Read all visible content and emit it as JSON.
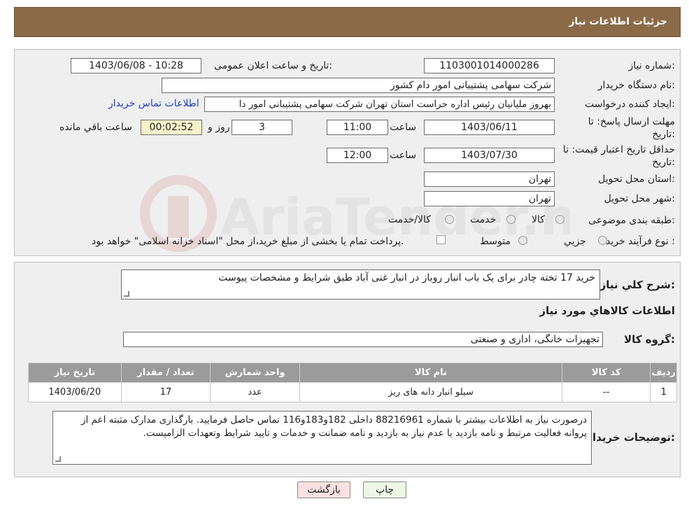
{
  "header": {
    "title": "جزئیات اطلاعات نیاز"
  },
  "form": {
    "need_number_label": "شماره نیاز:",
    "need_number": "1103001014000286",
    "announce_label": "تاریخ و ساعت اعلان عمومی:",
    "announce_value": "1403/06/08 - 10:28",
    "buyer_org_label": "نام دستگاه خریدار:",
    "buyer_org": "شرکت سهامی پشتیبانی امور دام کشور",
    "creator_label": "ایجاد کننده درخواست:",
    "creator": "بهروز ملیانیان رئیس اداره حراست استان تهران شرکت سهامی پشتیبانی امور دا",
    "contact_link": "اطلاعات تماس خریدار",
    "deadline_label": "مهلت ارسال پاسخ: تا تاریخ:",
    "deadline_date": "1403/06/11",
    "time_label": "ساعت",
    "deadline_time": "11:00",
    "days_value": "3",
    "days_label": "روز و",
    "remaining_time": "00:02:52",
    "remaining_label": "ساعت باقي مانده",
    "validity_label": "حداقل تاریخ اعتبار قیمت: تا تاریخ:",
    "validity_date": "1403/07/30",
    "validity_time": "12:00",
    "province_label": "استان محل تحویل:",
    "province": "تهران",
    "city_label": "شهر محل تحویل:",
    "city": "تهران",
    "category_label": "طبقه بندی موضوعی:",
    "category_options": [
      "کالا",
      "خدمت",
      "کالا/خدمت"
    ],
    "process_label": "نوع فرآیند خرید :",
    "process_options": [
      "جزیي",
      "متوسط"
    ],
    "process_note": "پرداخت تمام یا بخشی از مبلغ خرید،از محل \"اسناد خزانه اسلامی\" خواهد بود."
  },
  "details": {
    "summary_label": "شرح کلي نیاز:",
    "summary": "خرید 17 تخته چادر برای یک باب انبار روباز در انبار غنی آباد طبق شرایط و مشخصات پیوست",
    "goods_info_title": "اطلاعات کالاهاي مورد نیاز",
    "group_label": "گروه کالا:",
    "group_value": "تجهیزات خانگی، اداری و صنعتی",
    "table": {
      "headers": [
        "ردیف",
        "کد کالا",
        "نام کالا",
        "واحد شمارش",
        "تعداد / مقدار",
        "تاریخ نیاز"
      ],
      "rows": [
        [
          "1",
          "--",
          "سیلو انبار دانه های ریز",
          "عدد",
          "17",
          "1403/06/20"
        ]
      ]
    },
    "buyer_notes_label": "توضیحات خریدار:",
    "buyer_notes": "درصورت نیاز به اطلاعات بیشتر با شماره 88216961 داخلی 182و183و116 تماس حاصل فرمایید. بارگذاری مدارک مثبته اعم از پروانه فعالیت مرتبط و نامه بازدید یا عدم نیاز به بازدید و نامه ضمانت و خدمات و تایید شرایط وتعهدات الزامیست."
  },
  "buttons": {
    "print": "چاپ",
    "back": "بازگشت"
  },
  "watermark": {
    "text": "AriaTender.neT"
  },
  "colors": {
    "header_bg": "#8b6a47",
    "table_header_bg": "#9b9b9b",
    "timer_bg": "#f7f1c9",
    "link": "#1a3fbf"
  }
}
